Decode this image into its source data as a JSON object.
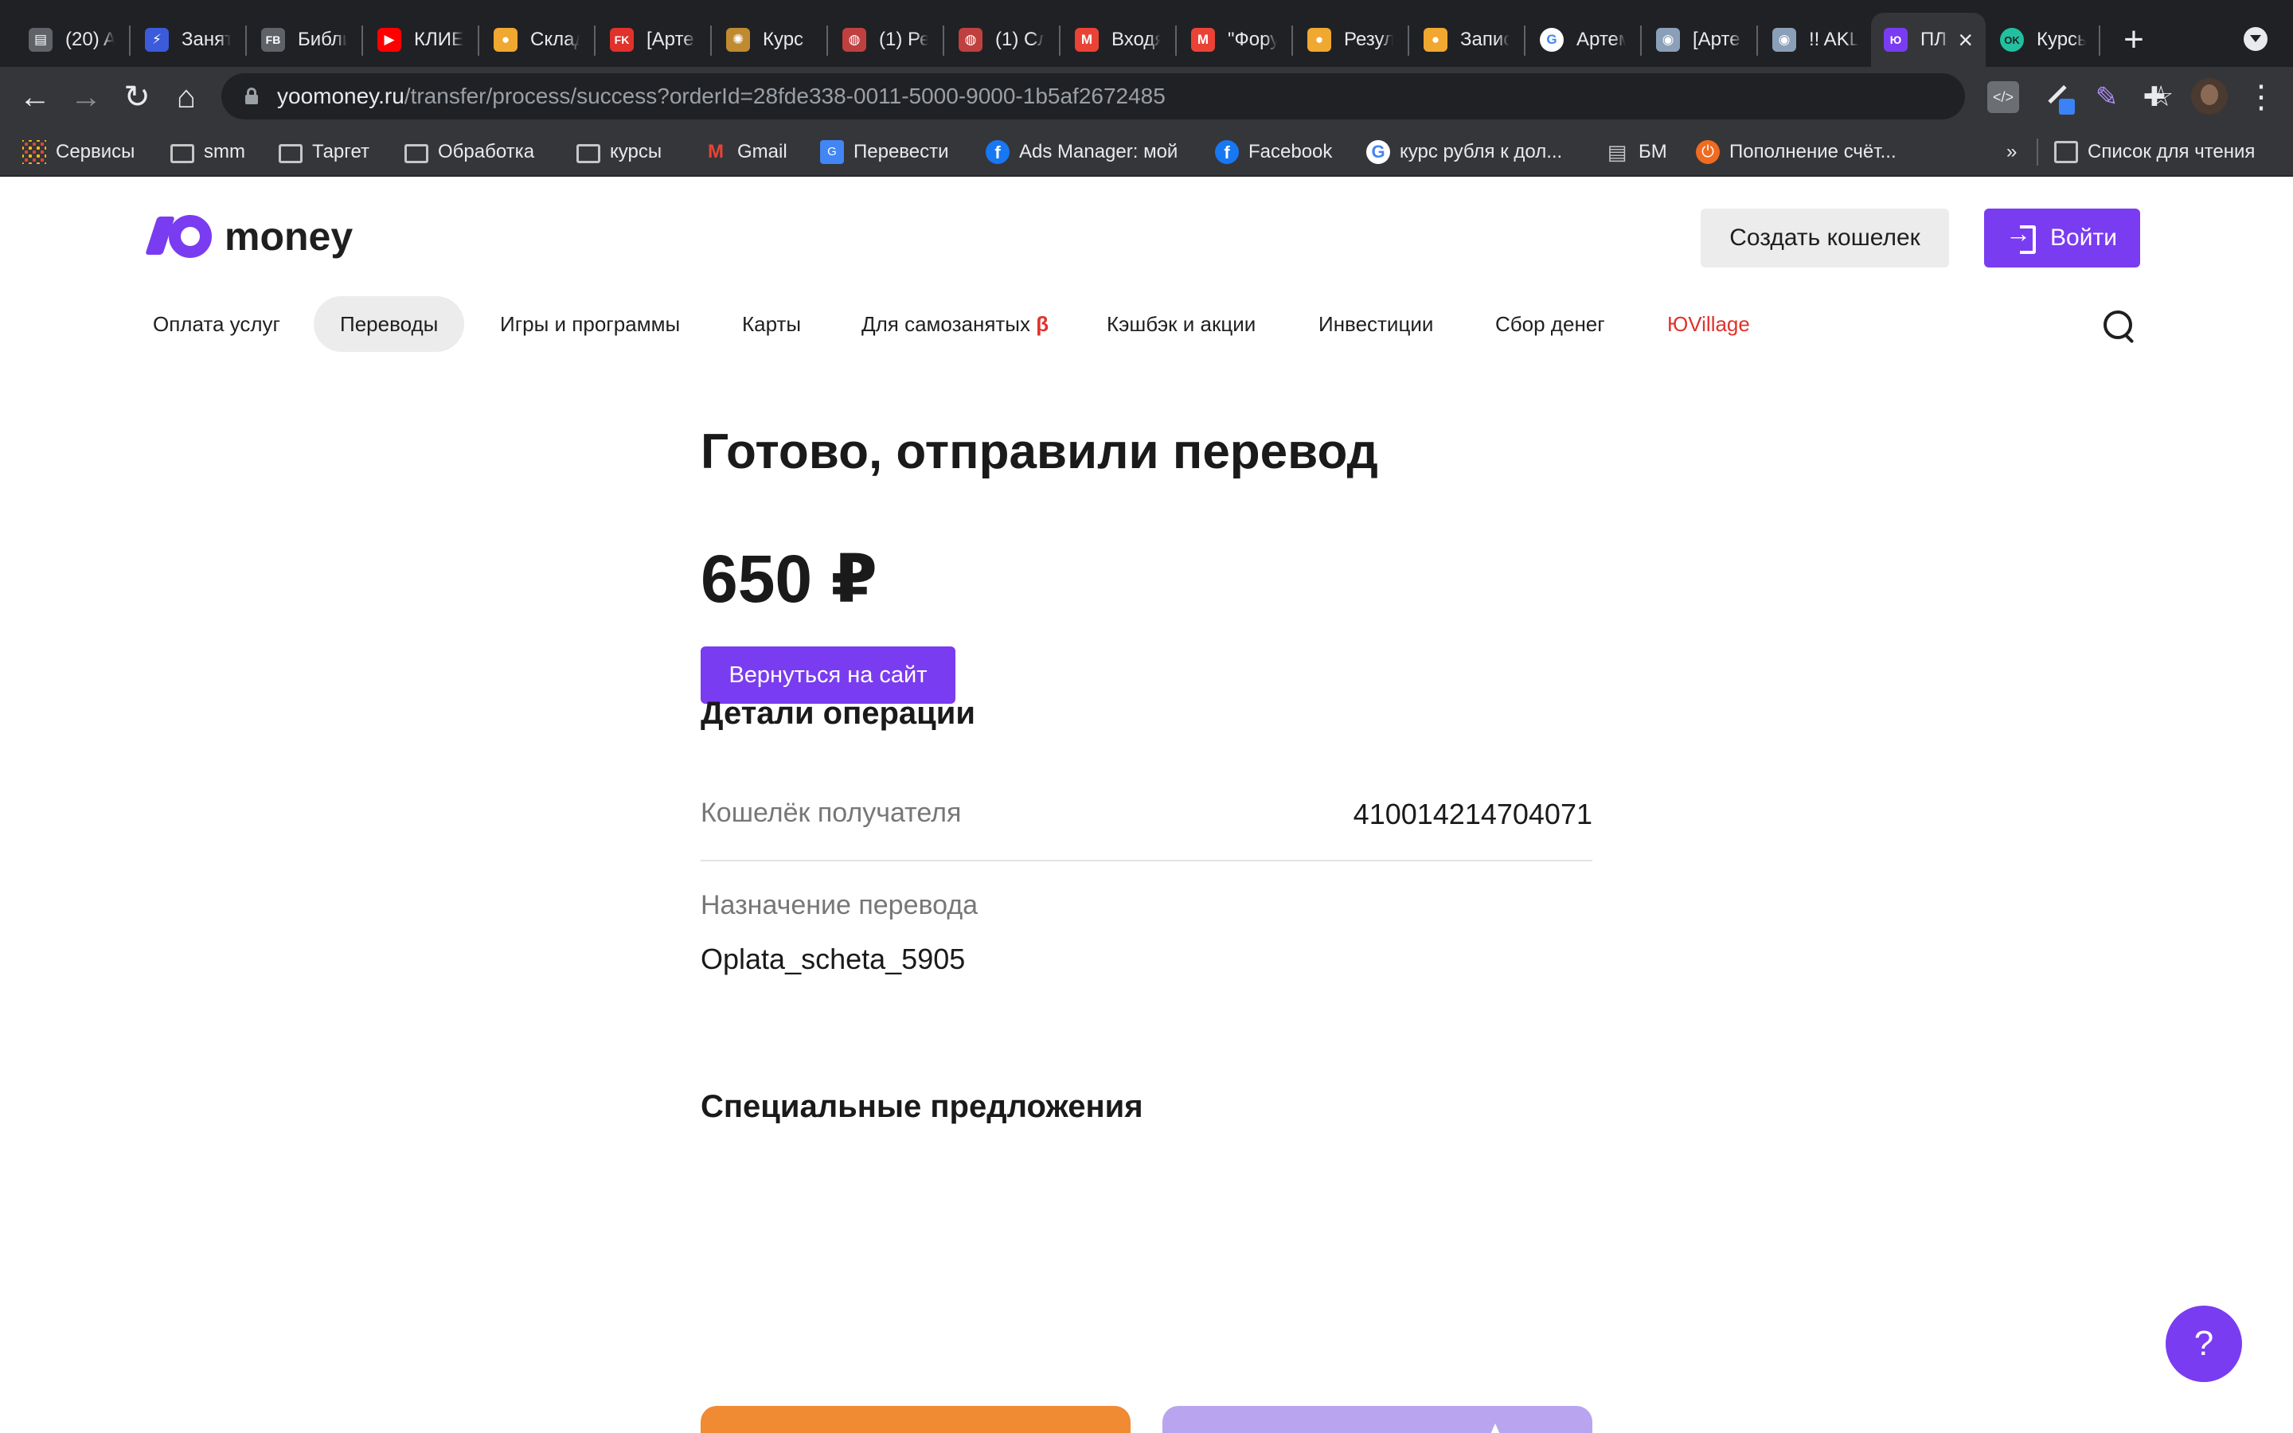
{
  "browser": {
    "tabs": [
      {
        "label": "(20) A",
        "icon": "printer-icon",
        "color": "#5f6368"
      },
      {
        "label": "Занят",
        "icon": "bolt-icon",
        "color": "#3b5bdb"
      },
      {
        "label": "Библи",
        "icon": "fb-library-icon",
        "color": "#5f6368"
      },
      {
        "label": "КЛИЕ",
        "icon": "youtube-icon",
        "color": "#ff0000"
      },
      {
        "label": "Склад",
        "icon": "coins-icon",
        "color": "#f0a830"
      },
      {
        "label": "[Арте",
        "icon": "fk-icon",
        "color": "#e0322b"
      },
      {
        "label": "Курс",
        "icon": "sunburst-icon",
        "color": "#c08a30"
      },
      {
        "label": "(1) Ре",
        "icon": "pin-icon",
        "color": "#c04040"
      },
      {
        "label": "(1) Сл",
        "icon": "pin-icon",
        "color": "#c04040"
      },
      {
        "label": "Входя",
        "icon": "gmail-icon",
        "color": "#ea4335"
      },
      {
        "label": "\"Фору",
        "icon": "gmail-icon",
        "color": "#ea4335"
      },
      {
        "label": "Резул",
        "icon": "coins-icon",
        "color": "#f0a830"
      },
      {
        "label": "Запис",
        "icon": "coins-icon",
        "color": "#f0a830"
      },
      {
        "label": "Артем",
        "icon": "google-icon",
        "color": "#4285f4"
      },
      {
        "label": "[Арте",
        "icon": "globe-icon",
        "color": "#8aa0b8"
      },
      {
        "label": "!! AKL",
        "icon": "globe-icon",
        "color": "#8aa0b8"
      },
      {
        "label": "ПЛ",
        "icon": "yoomoney-icon",
        "color": "#7a3cf0"
      },
      {
        "label": "Курсы",
        "icon": "ok-icon",
        "color": "#21c0a0"
      }
    ],
    "active_tab_index": 16,
    "url_host": "yoomoney.ru",
    "url_path": "/transfer/process/success?orderId=28fde338-0011-5000-9000-1b5af2672485",
    "bookmarks": [
      {
        "label": "Сервисы",
        "icon": "apps-grid-icon"
      },
      {
        "label": "smm",
        "icon": "folder-icon"
      },
      {
        "label": "Таргет",
        "icon": "folder-icon"
      },
      {
        "label": "Обработка",
        "icon": "folder-icon"
      },
      {
        "label": "курсы",
        "icon": "folder-icon"
      },
      {
        "label": "Gmail",
        "icon": "gmail-icon"
      },
      {
        "label": "Перевести",
        "icon": "translate-icon"
      },
      {
        "label": "Ads Manager: мой",
        "icon": "facebook-icon"
      },
      {
        "label": "Facebook",
        "icon": "facebook-icon"
      },
      {
        "label": "курс рубля к дол...",
        "icon": "google-icon"
      },
      {
        "label": "БМ",
        "icon": "printer-icon"
      },
      {
        "label": "Пополнение счёт...",
        "icon": "power-icon"
      }
    ],
    "more_bookmarks": "»",
    "reading_list": "Список для чтения"
  },
  "site": {
    "logo_text": "money",
    "create_wallet": "Создать кошелек",
    "login": "Войти",
    "nav": [
      {
        "label": "Оплата услуг"
      },
      {
        "label": "Переводы"
      },
      {
        "label": "Игры и программы"
      },
      {
        "label": "Карты"
      },
      {
        "label": "Для самозанятых",
        "badge": "β"
      },
      {
        "label": "Кэшбэк и акции"
      },
      {
        "label": "Инвестиции"
      },
      {
        "label": "Сбор денег"
      },
      {
        "label": "ЮVillage"
      }
    ],
    "active_nav_index": 1
  },
  "result": {
    "title": "Готово, отправили перевод",
    "amount": "650 ₽",
    "back_button": "Вернуться на сайт",
    "details_heading": "Детали операции",
    "wallet_label": "Кошелёк получателя",
    "wallet_value": "410014214704071",
    "purpose_label": "Назначение перевода",
    "purpose_value": "Oplata_scheta_5905",
    "special_heading": "Специальные предложения"
  },
  "help_label": "?",
  "colors": {
    "brand": "#7a3cf0",
    "accent_red": "#e0322b",
    "offer_orange": "#f08a33",
    "offer_lilac": "#b9a4ef"
  }
}
